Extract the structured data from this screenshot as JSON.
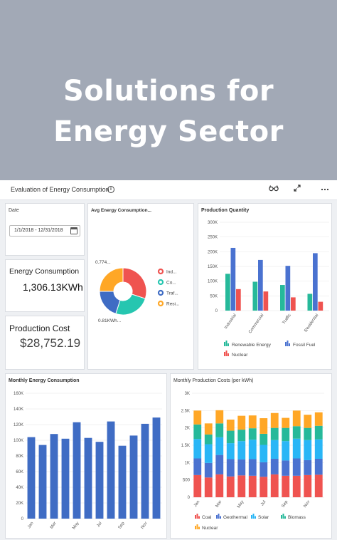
{
  "hero": {
    "title_line1": "Solutions for",
    "title_line2": "Energy Sector"
  },
  "toolbar": {
    "title": "Evaluation of Energy Consumption",
    "info_icon": "info-icon",
    "view_icon": "glasses-icon",
    "expand_icon": "expand-icon",
    "more_icon": "more-icon"
  },
  "date_card": {
    "label": "Date",
    "value": "1/1/2018 - 12/31/2018",
    "icon": "calendar-icon"
  },
  "kpi_consumption": {
    "label": "Energy Consumption",
    "value": "1,306.13KWh"
  },
  "kpi_cost": {
    "label": "Production Cost",
    "value": "$28,752.19"
  },
  "donut": {
    "title": "Avg Energy Consumption...",
    "callout_top": "0.774...",
    "callout_bottom": "0.81KWh...",
    "legend": [
      "Ind...",
      "Co...",
      "Traf...",
      "Resi..."
    ],
    "colors": [
      "#ef5350",
      "#26c6b0",
      "#3f6cc4",
      "#ffa726"
    ],
    "chart_data": {
      "type": "pie",
      "labels": [
        "Ind...",
        "Co...",
        "Traf...",
        "Resi..."
      ],
      "values": [
        30,
        25,
        20,
        25
      ]
    }
  },
  "production_quantity": {
    "title": "Production Quantity",
    "legend": [
      "Renewable Energy",
      "Fossil Fuel",
      "Nuclear"
    ],
    "colors": [
      "#26b99a",
      "#4a72d0",
      "#ef5350"
    ],
    "chart_data": {
      "type": "bar",
      "categories": [
        "Industrial",
        "Commercial",
        "Traffic",
        "Residential"
      ],
      "series": [
        {
          "name": "Renewable Energy",
          "values": [
            125000,
            98000,
            87000,
            57000
          ]
        },
        {
          "name": "Fossil Fuel",
          "values": [
            213000,
            172000,
            152000,
            195000
          ]
        },
        {
          "name": "Nuclear",
          "values": [
            73000,
            65000,
            45000,
            30000
          ]
        }
      ],
      "ylim": [
        0,
        300000
      ],
      "yticks": [
        "0",
        "50K",
        "100K",
        "150K",
        "200K",
        "250K",
        "300K"
      ]
    }
  },
  "monthly_consumption": {
    "title": "Monthly Energy Consumption",
    "color": "#3f6cc4",
    "chart_data": {
      "type": "bar",
      "categories": [
        "Jan",
        "Feb",
        "Mar",
        "Apr",
        "May",
        "Jun",
        "Jul",
        "Aug",
        "Sep",
        "Oct",
        "Nov",
        "Dec"
      ],
      "xtick_labels": [
        "Jan",
        "Mar",
        "May",
        "Jul",
        "Sep",
        "Nov"
      ],
      "values": [
        104000,
        94000,
        108000,
        102000,
        123000,
        103000,
        98000,
        124000,
        93000,
        106000,
        121000,
        129000
      ],
      "ylim": [
        0,
        160000
      ],
      "yticks": [
        "0",
        "20K",
        "40K",
        "60K",
        "80K",
        "100K",
        "120K",
        "140K",
        "160K"
      ]
    }
  },
  "monthly_costs": {
    "title": "Monthly Production Costs (per kWh)",
    "legend": [
      "Coal",
      "Geothermal",
      "Solar",
      "Biomass",
      "Nuclear"
    ],
    "colors": [
      "#ef5350",
      "#4a72d0",
      "#29b6f6",
      "#26b99a",
      "#ffa726"
    ],
    "chart_data": {
      "type": "bar",
      "stacked": true,
      "categories": [
        "Jan",
        "Feb",
        "Mar",
        "Apr",
        "May",
        "Jun",
        "Jul",
        "Aug",
        "Sep",
        "Oct",
        "Nov",
        "Dec"
      ],
      "xtick_labels": [
        "Jan",
        "Mar",
        "May",
        "Jul",
        "Sep",
        "Nov"
      ],
      "series": [
        {
          "name": "Coal",
          "values": [
            640,
            570,
            660,
            600,
            630,
            620,
            590,
            660,
            620,
            620,
            640,
            650
          ]
        },
        {
          "name": "Geothermal",
          "values": [
            480,
            420,
            560,
            500,
            460,
            480,
            420,
            450,
            440,
            500,
            430,
            460
          ]
        },
        {
          "name": "Solar",
          "values": [
            560,
            540,
            510,
            460,
            530,
            560,
            500,
            540,
            560,
            570,
            580,
            560
          ]
        },
        {
          "name": "Biomass",
          "values": [
            420,
            280,
            400,
            360,
            330,
            330,
            320,
            350,
            380,
            360,
            350,
            390
          ]
        },
        {
          "name": "Nuclear",
          "values": [
            400,
            320,
            380,
            320,
            400,
            370,
            450,
            430,
            290,
            450,
            380,
            390
          ]
        }
      ],
      "ylim": [
        0,
        3000
      ],
      "yticks": [
        "0",
        "500",
        "1K",
        "1.5K",
        "2K",
        "2.5K",
        "3K"
      ]
    }
  }
}
